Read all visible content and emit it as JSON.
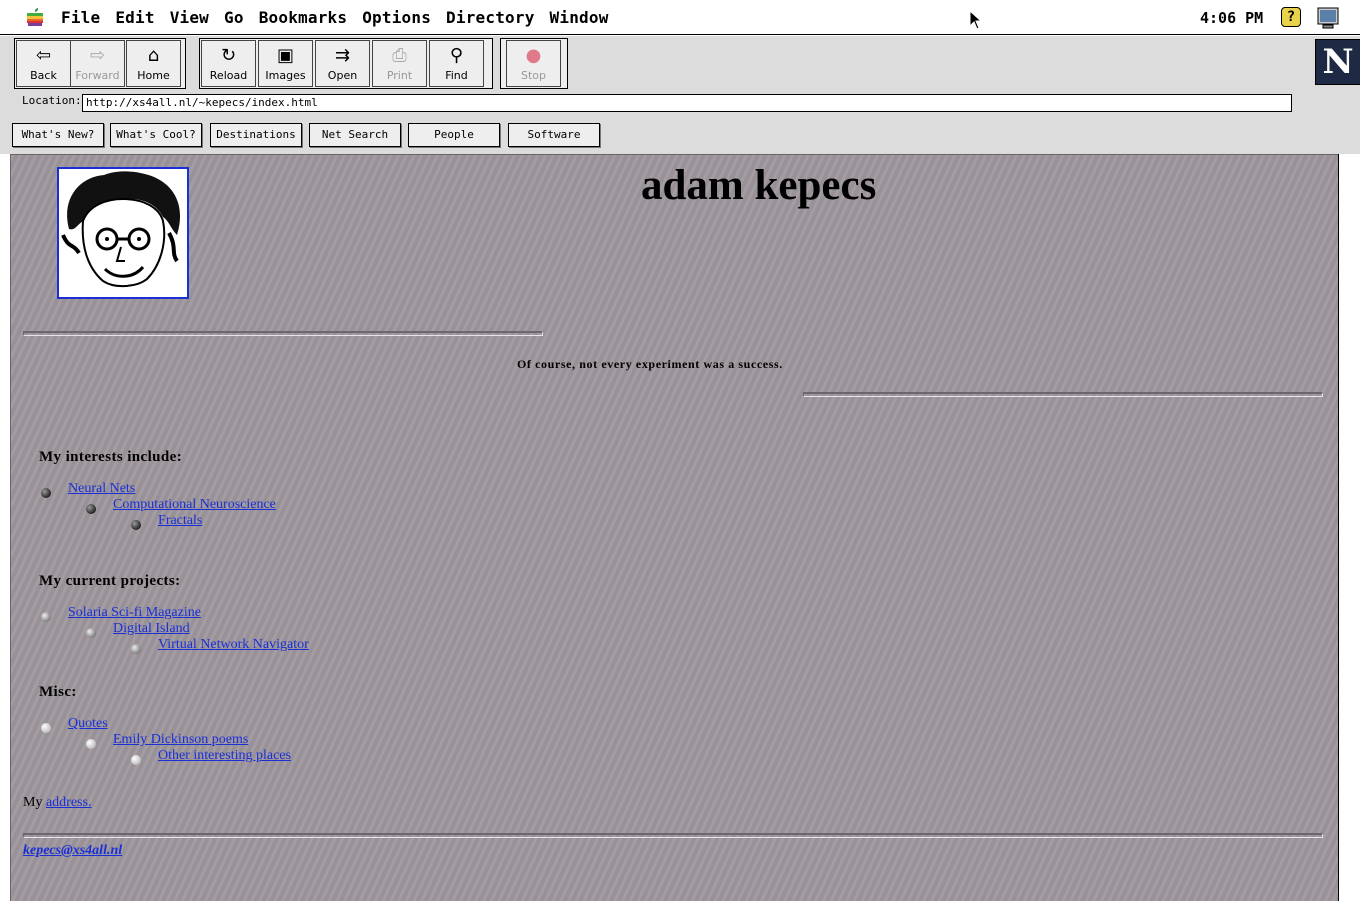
{
  "menubar": {
    "menus": [
      "File",
      "Edit",
      "View",
      "Go",
      "Bookmarks",
      "Options",
      "Directory",
      "Window"
    ],
    "clock": "4:06 PM",
    "help": "?"
  },
  "toolbar": {
    "back": "Back",
    "forward": "Forward",
    "home": "Home",
    "reload": "Reload",
    "images": "Images",
    "open": "Open",
    "print": "Print",
    "find": "Find",
    "stop": "Stop",
    "logo": "N"
  },
  "location": {
    "label": "Location:",
    "url": "http://xs4all.nl/~kepecs/index.html"
  },
  "directory": [
    "What's New?",
    "What's Cool?",
    "Destinations",
    "Net Search",
    "People",
    "Software"
  ],
  "page": {
    "title": "adam kepecs",
    "quote": "Of course, not every experiment was a success.",
    "sections": [
      {
        "heading": "My interests include:",
        "items": [
          "Neural Nets",
          "Computational Neuroscience",
          "Fractals"
        ]
      },
      {
        "heading": "My current projects:",
        "items": [
          "Solaria Sci-fi Magazine",
          "Digital Island",
          "Virtual Network Navigator"
        ]
      },
      {
        "heading": "Misc:",
        "items": [
          "Quotes",
          "Emily Dickinson poems",
          "Other interesting places"
        ]
      }
    ],
    "address_prefix": "My",
    "address_link": "address.",
    "email": "kepecs@xs4all.nl"
  }
}
